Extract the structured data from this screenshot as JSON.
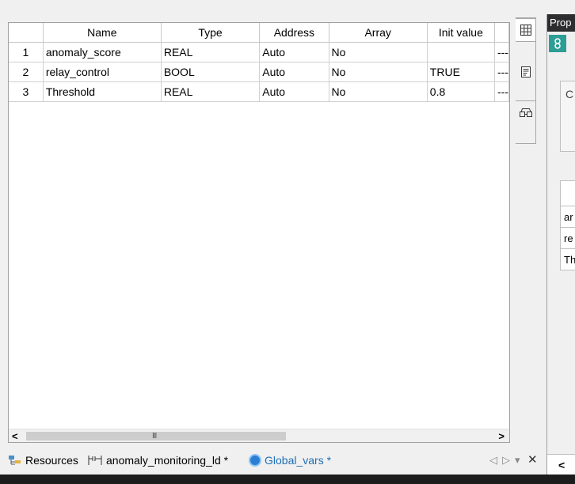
{
  "grid": {
    "columns": [
      "Name",
      "Type",
      "Address",
      "Array",
      "Init value",
      ""
    ],
    "rows": [
      {
        "num": "1",
        "name": "anomaly_score",
        "type": "REAL",
        "address": "Auto",
        "array": "No",
        "init": "",
        "extra": "---"
      },
      {
        "num": "2",
        "name": "relay_control",
        "type": "BOOL",
        "address": "Auto",
        "array": "No",
        "init": "TRUE",
        "extra": "---"
      },
      {
        "num": "3",
        "name": "Threshold",
        "type": "REAL",
        "address": "Auto",
        "array": "No",
        "init": "0.8",
        "extra": "---"
      }
    ]
  },
  "scrollbar": {
    "left_arrow": "<",
    "right_arrow": ">",
    "grip": "III"
  },
  "properties": {
    "title": "Prop",
    "box_char": "C",
    "rows": [
      "ar",
      "re",
      "Th"
    ],
    "bottom_char": "<"
  },
  "tabs": [
    {
      "label": "Resources",
      "icon": "resources-icon"
    },
    {
      "label": "anomaly_monitoring_ld *",
      "icon": "ladder-icon"
    },
    {
      "label": "Global_vars *",
      "icon": "global-vars-icon"
    }
  ],
  "strip_controls": {
    "prev": "◁",
    "next": "▷",
    "menu": "▾",
    "close": "✕"
  }
}
